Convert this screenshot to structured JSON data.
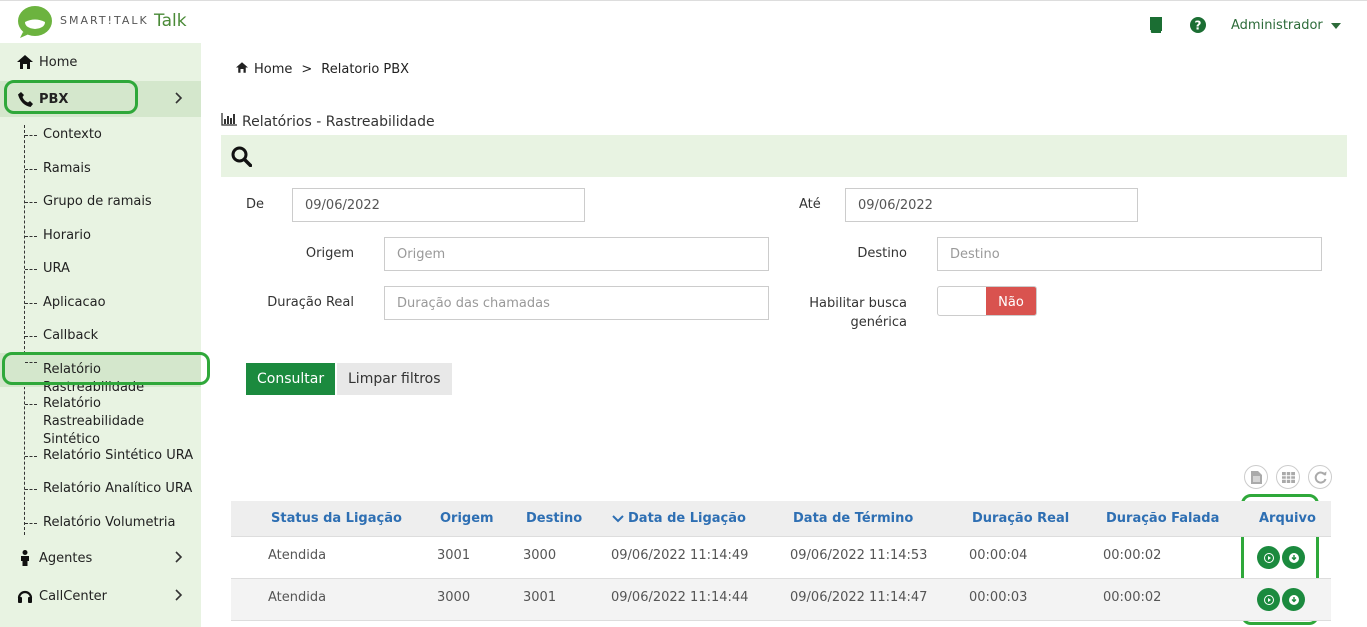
{
  "header": {
    "brand": "SMART!TALK",
    "brand_sub": "Talk",
    "user": "Administrador",
    "icons": [
      "book-icon",
      "help-icon"
    ]
  },
  "sidebar": {
    "items": [
      {
        "label": "Home",
        "icon": "home-icon"
      },
      {
        "label": "PBX",
        "icon": "phone-icon"
      },
      {
        "label": "Agentes",
        "icon": "person-icon"
      },
      {
        "label": "CallCenter",
        "icon": "headset-icon"
      }
    ],
    "pbx_sub": [
      {
        "label": "Contexto"
      },
      {
        "label": "Ramais"
      },
      {
        "label": "Grupo de ramais"
      },
      {
        "label": "Horario"
      },
      {
        "label": "URA"
      },
      {
        "label": "Aplicacao"
      },
      {
        "label": "Callback"
      },
      {
        "label": "Relatório Rastreabilidade"
      },
      {
        "label": "Relatório Rastreabilidade",
        "label2": "Sintético"
      },
      {
        "label": "Relatório Sintético URA"
      },
      {
        "label": "Relatório Analítico URA"
      },
      {
        "label": "Relatório Volumetria"
      }
    ]
  },
  "breadcrumb": {
    "home": "Home",
    "sep": ">",
    "current": "Relatorio PBX"
  },
  "page": {
    "title": "Relatórios - Rastreabilidade"
  },
  "filters": {
    "de_label": "De",
    "de_value": "09/06/2022",
    "ate_label": "Até",
    "ate_value": "09/06/2022",
    "origem_label": "Origem",
    "origem_placeholder": "Origem",
    "destino_label": "Destino",
    "destino_placeholder": "Destino",
    "duracao_label": "Duração Real",
    "duracao_placeholder": "Duração das chamadas",
    "busca_label_1": "Habilitar busca",
    "busca_label_2": "genérica",
    "busca_toggle": "Não"
  },
  "buttons": {
    "consultar": "Consultar",
    "limpar": "Limpar filtros"
  },
  "table": {
    "headers": [
      "Status da Ligação",
      "Origem",
      "Destino",
      "Data de Ligação",
      "Data de Término",
      "Duração Real",
      "Duração Falada",
      "Arquivo"
    ],
    "rows": [
      [
        "Atendida",
        "3001",
        "3000",
        "09/06/2022 11:14:49",
        "09/06/2022 11:14:53",
        "00:00:04",
        "00:00:02"
      ],
      [
        "Atendida",
        "3000",
        "3001",
        "09/06/2022 11:14:44",
        "09/06/2022 11:14:47",
        "00:00:03",
        "00:00:02"
      ]
    ]
  },
  "colors": {
    "accent": "#1b8a3e",
    "sidebar_bg": "#e8f3e2",
    "highlight": "#2fa83a",
    "toggle_off": "#d9534f",
    "header_link": "#2e6fb3"
  }
}
